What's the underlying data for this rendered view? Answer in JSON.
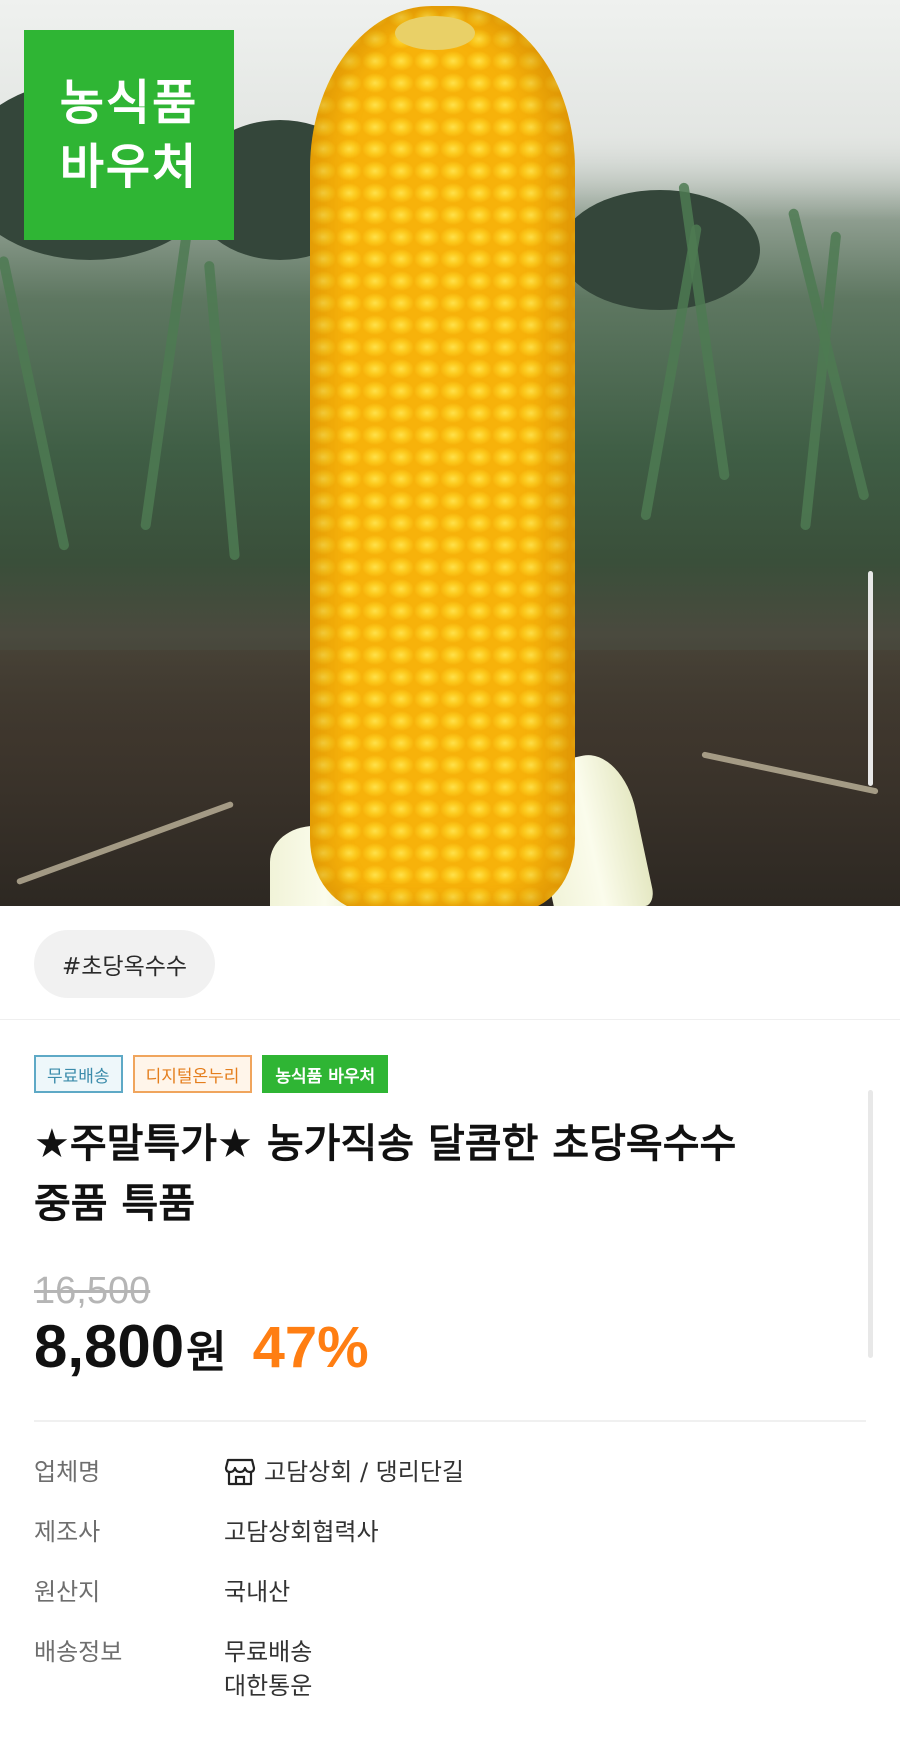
{
  "hero": {
    "badge_line1": "농식품",
    "badge_line2": "바우처"
  },
  "tag_chip": "#초당옥수수",
  "labels": [
    "무료배송",
    "디지털온누리",
    "농식품 바우처"
  ],
  "product": {
    "title_line1": "★주말특가★ 농가직송 달콤한 초당옥수수",
    "title_line2": "중품 특품",
    "original_price": "16,500",
    "price": "8,800",
    "currency": "원",
    "discount": "47%"
  },
  "info": {
    "seller_label": "업체명",
    "seller_value": "고담상회 / 댕리단길",
    "maker_label": "제조사",
    "maker_value": "고담상회협력사",
    "origin_label": "원산지",
    "origin_value": "국내산",
    "shipping_label": "배송정보",
    "shipping_value_1": "무료배송",
    "shipping_value_2": "대한통운"
  },
  "colors": {
    "voucher_green": "#2fb534",
    "discount_orange": "#ff7e12"
  },
  "icons": [
    "store-icon"
  ]
}
